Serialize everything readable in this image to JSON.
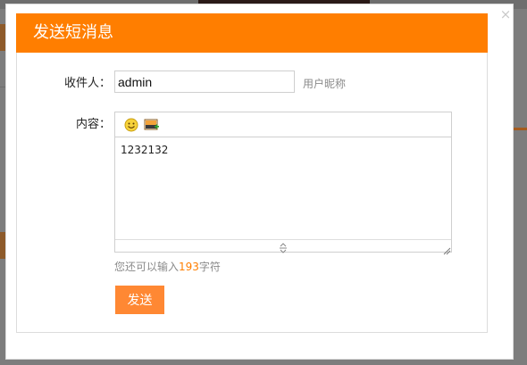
{
  "dialog": {
    "title": "发送短消息",
    "close_symbol": "×",
    "close_icon": "close-icon"
  },
  "form": {
    "recipient_label": "收件人：",
    "recipient_value": "admin",
    "recipient_hint": "用户昵称",
    "content_label": "内容：",
    "content_value": "1232132",
    "toolbar": {
      "emoji_icon": "smiley-icon",
      "image_icon": "insert-image-icon"
    },
    "counter_prefix": "您还可以输入",
    "counter_value": "193",
    "counter_suffix": "字符",
    "send_label": "发送"
  },
  "colors": {
    "accent": "#ff7e00",
    "button": "#ff8833",
    "overlay": "#7d7d7d"
  }
}
